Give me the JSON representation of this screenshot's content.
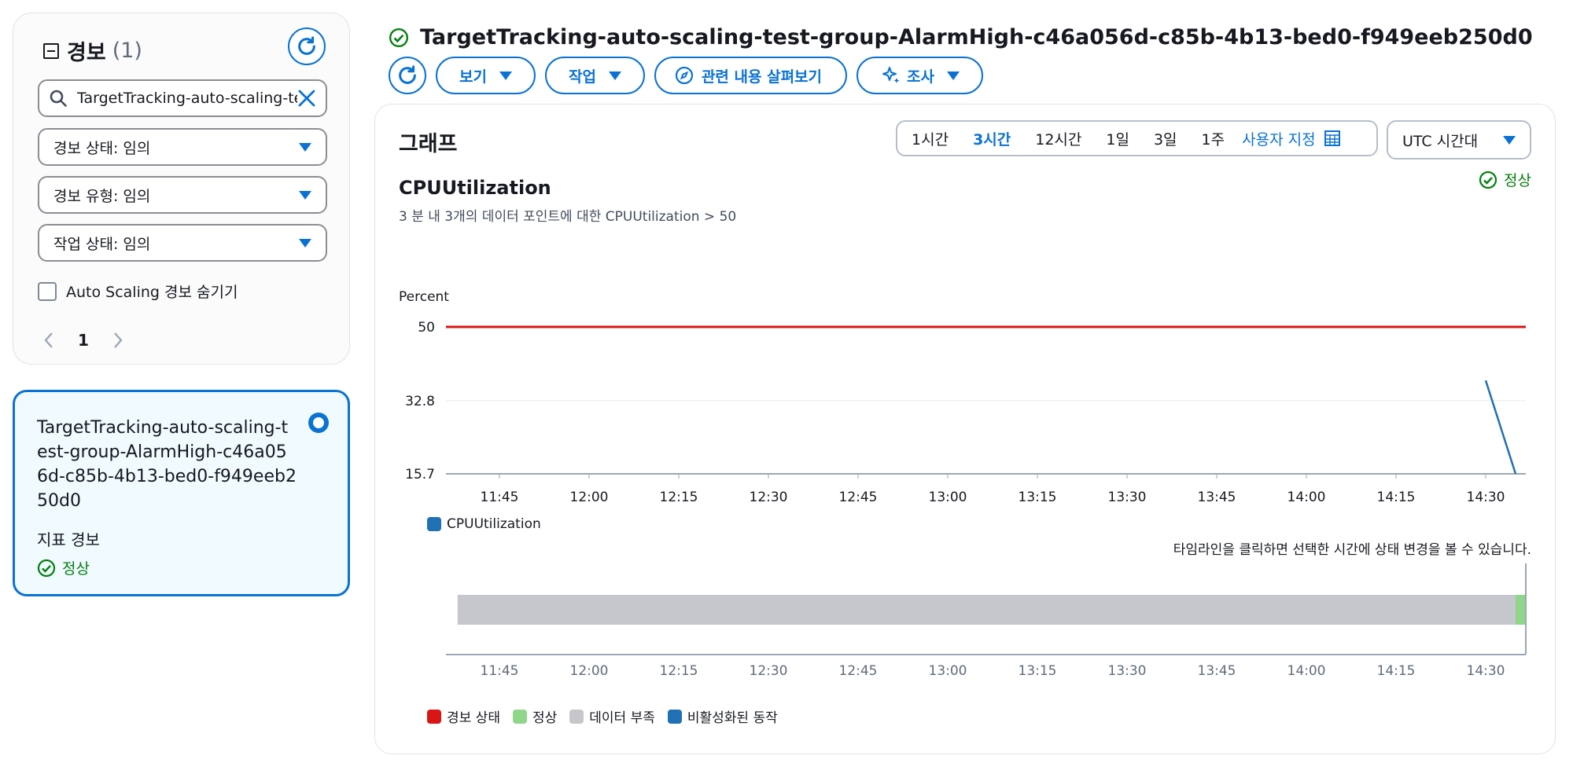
{
  "filter_panel": {
    "title": "경보",
    "count": "(1)",
    "search_value": "TargetTracking-auto-scaling-test-group",
    "filters": [
      {
        "label": "경보 상태: 임의"
      },
      {
        "label": "경보 유형: 임의"
      },
      {
        "label": "작업 상태: 임의"
      }
    ],
    "hide_autoscaling_label": "Auto Scaling 경보 숨기기",
    "page": "1"
  },
  "alarm_card": {
    "name": "TargetTracking-auto-scaling-test-group-AlarmHigh-c46a056d-c85b-4b13-bed0-f949eeb250d0",
    "type": "지표 경보",
    "state": "정상"
  },
  "header": {
    "title": "TargetTracking-auto-scaling-test-group-AlarmHigh-c46a056d-c85b-4b13-bed0-f949eeb250d0",
    "buttons": {
      "view": "보기",
      "actions": "작업",
      "explore": "관련 내용 살펴보기",
      "investigate": "조사"
    }
  },
  "graph": {
    "title": "그래프",
    "ranges": [
      "1시간",
      "3시간",
      "12시간",
      "1일",
      "3일",
      "1주"
    ],
    "active_range": "3시간",
    "custom_label": "사용자 지정",
    "timezone": "UTC 시간대",
    "metric_title": "CPUUtilization",
    "metric_subtitle": "3 분 내 3개의 데이터 포인트에 대한 CPUUtilization > 50",
    "state": "정상",
    "timeline_hint": "타임라인을 클릭하면 선택한 시간에 상태 변경을 볼 수 있습니다.",
    "state_legend": [
      {
        "label": "경보 상태",
        "color": "#d91515"
      },
      {
        "label": "정상",
        "color": "#8fd68a"
      },
      {
        "label": "데이터 부족",
        "color": "#c6c6cd"
      },
      {
        "label": "비활성화된 동작",
        "color": "#1f70b4"
      }
    ]
  },
  "chart_data": {
    "type": "line",
    "ylabel": "Percent",
    "y_ticks": [
      "50",
      "32.8",
      "15.7"
    ],
    "ylim": [
      15.7,
      50
    ],
    "x_ticks": [
      "11:45",
      "12:00",
      "12:15",
      "12:30",
      "12:45",
      "13:00",
      "13:15",
      "13:30",
      "13:45",
      "14:00",
      "14:15",
      "14:30"
    ],
    "threshold": {
      "value": 50,
      "color": "#d91515"
    },
    "series": [
      {
        "name": "CPUUtilization",
        "color": "#1f70b4",
        "x": [
          "14:30",
          "14:35"
        ],
        "y": [
          37.5,
          15.7
        ]
      }
    ],
    "timeline": [
      {
        "state": "데이터 부족",
        "from": "11:38",
        "to": "14:35",
        "color": "#c6c6cd"
      },
      {
        "state": "정상",
        "from": "14:35",
        "to": "14:38",
        "color": "#8fd68a"
      }
    ]
  }
}
